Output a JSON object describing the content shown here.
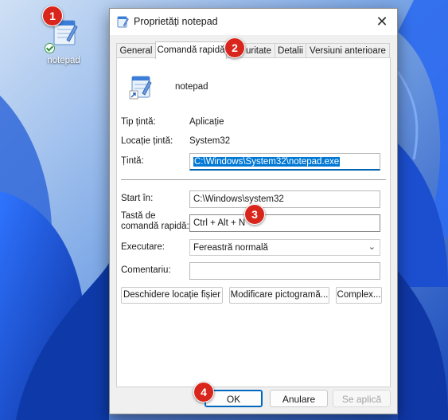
{
  "window": {
    "title": "Proprietăți notepad"
  },
  "desktop": {
    "icon_label": "notepad"
  },
  "tabs": [
    {
      "label": "General"
    },
    {
      "label": "Comandă rapidă"
    },
    {
      "label": "uritate"
    },
    {
      "label": "Detalii"
    },
    {
      "label": "Versiuni anterioare"
    }
  ],
  "shortcut": {
    "app_name": "notepad",
    "target_type_label": "Tip țintă:",
    "target_type_value": "Aplicație",
    "target_location_label": "Locație țintă:",
    "target_location_value": "System32",
    "target_label": "Țintă:",
    "target_value": "C:\\Windows\\System32\\notepad.exe",
    "start_in_label": "Start în:",
    "start_in_value": "C:\\Windows\\system32",
    "hotkey_label_line1": "Tastă de",
    "hotkey_label_line2": "comandă rapidă:",
    "hotkey_value": "Ctrl + Alt + N",
    "run_label": "Executare:",
    "run_value": "Fereastră normală",
    "comment_label": "Comentariu:",
    "comment_value": ""
  },
  "panel_buttons": {
    "open_location": "Deschidere locație fișier",
    "change_icon": "Modificare pictogramă...",
    "advanced": "Complex..."
  },
  "dialog_buttons": {
    "ok": "OK",
    "cancel": "Anulare",
    "apply": "Se aplică"
  },
  "callouts": [
    "1",
    "2",
    "3",
    "4"
  ],
  "colors": {
    "accent": "#0078d4",
    "callout": "#d9261c",
    "wallpaper": "#1b4fc0"
  }
}
